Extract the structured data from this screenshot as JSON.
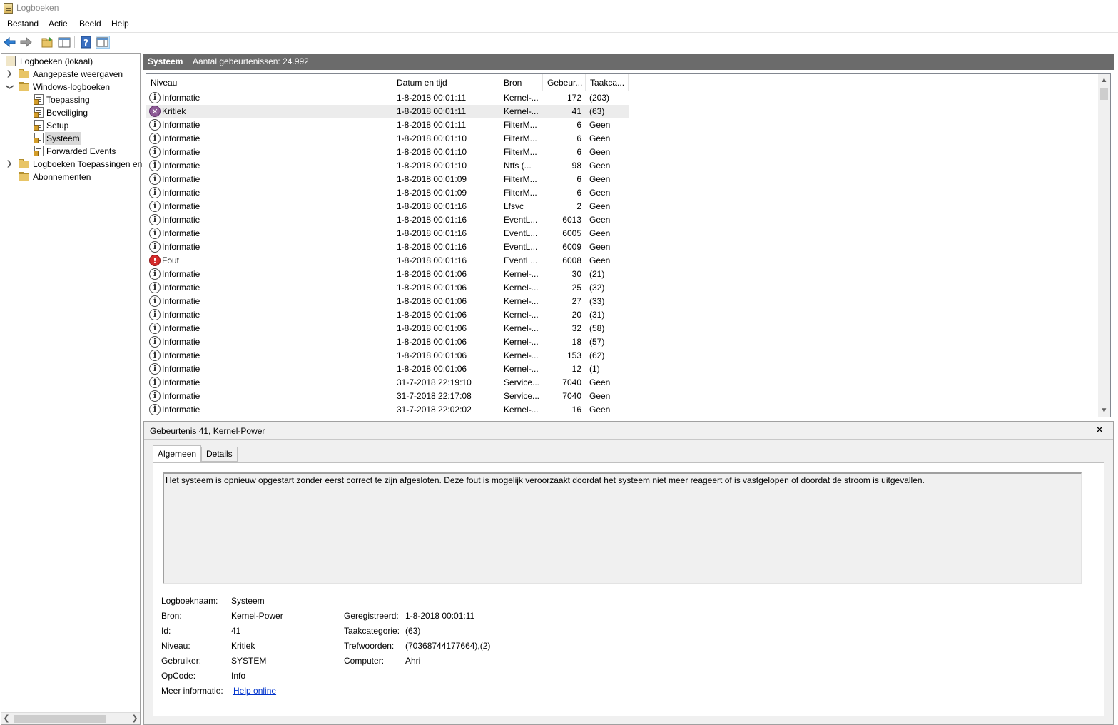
{
  "window": {
    "title": "Logboeken"
  },
  "menu": {
    "bestand": "Bestand",
    "actie": "Actie",
    "beeld": "Beeld",
    "help": "Help"
  },
  "toolbar": {
    "icons": [
      "back-arrow-icon",
      "forward-arrow-icon",
      "open-folder-icon",
      "show-hide-tree-icon",
      "help-icon",
      "show-hide-action-pane-icon"
    ]
  },
  "tree": {
    "root": "Logboeken (lokaal)",
    "custom_views": "Aangepaste weergaven",
    "windows_logs": "Windows-logboeken",
    "toepassing": "Toepassing",
    "beveiliging": "Beveiliging",
    "setup": "Setup",
    "systeem": "Systeem",
    "forwarded": "Forwarded Events",
    "app_logs": "Logboeken Toepassingen en",
    "subscriptions": "Abonnementen"
  },
  "header": {
    "name": "Systeem",
    "count": "Aantal gebeurtenissen: 24.992"
  },
  "columns": {
    "niveau": "Niveau",
    "datum": "Datum en tijd",
    "bron": "Bron",
    "id": "Gebeur...",
    "taak": "Taakca..."
  },
  "rows": [
    {
      "level": "Informatie",
      "type": "info",
      "date": "1-8-2018 00:01:11",
      "source": "Kernel-...",
      "id": "172",
      "task": "(203)"
    },
    {
      "level": "Kritiek",
      "type": "crit",
      "date": "1-8-2018 00:01:11",
      "source": "Kernel-...",
      "id": "41",
      "task": "(63)"
    },
    {
      "level": "Informatie",
      "type": "info",
      "date": "1-8-2018 00:01:11",
      "source": "FilterM...",
      "id": "6",
      "task": "Geen"
    },
    {
      "level": "Informatie",
      "type": "info",
      "date": "1-8-2018 00:01:10",
      "source": "FilterM...",
      "id": "6",
      "task": "Geen"
    },
    {
      "level": "Informatie",
      "type": "info",
      "date": "1-8-2018 00:01:10",
      "source": "FilterM...",
      "id": "6",
      "task": "Geen"
    },
    {
      "level": "Informatie",
      "type": "info",
      "date": "1-8-2018 00:01:10",
      "source": "Ntfs (...",
      "id": "98",
      "task": "Geen"
    },
    {
      "level": "Informatie",
      "type": "info",
      "date": "1-8-2018 00:01:09",
      "source": "FilterM...",
      "id": "6",
      "task": "Geen"
    },
    {
      "level": "Informatie",
      "type": "info",
      "date": "1-8-2018 00:01:09",
      "source": "FilterM...",
      "id": "6",
      "task": "Geen"
    },
    {
      "level": "Informatie",
      "type": "info",
      "date": "1-8-2018 00:01:16",
      "source": "Lfsvc",
      "id": "2",
      "task": "Geen"
    },
    {
      "level": "Informatie",
      "type": "info",
      "date": "1-8-2018 00:01:16",
      "source": "EventL...",
      "id": "6013",
      "task": "Geen"
    },
    {
      "level": "Informatie",
      "type": "info",
      "date": "1-8-2018 00:01:16",
      "source": "EventL...",
      "id": "6005",
      "task": "Geen"
    },
    {
      "level": "Informatie",
      "type": "info",
      "date": "1-8-2018 00:01:16",
      "source": "EventL...",
      "id": "6009",
      "task": "Geen"
    },
    {
      "level": "Fout",
      "type": "err",
      "date": "1-8-2018 00:01:16",
      "source": "EventL...",
      "id": "6008",
      "task": "Geen"
    },
    {
      "level": "Informatie",
      "type": "info",
      "date": "1-8-2018 00:01:06",
      "source": "Kernel-...",
      "id": "30",
      "task": "(21)"
    },
    {
      "level": "Informatie",
      "type": "info",
      "date": "1-8-2018 00:01:06",
      "source": "Kernel-...",
      "id": "25",
      "task": "(32)"
    },
    {
      "level": "Informatie",
      "type": "info",
      "date": "1-8-2018 00:01:06",
      "source": "Kernel-...",
      "id": "27",
      "task": "(33)"
    },
    {
      "level": "Informatie",
      "type": "info",
      "date": "1-8-2018 00:01:06",
      "source": "Kernel-...",
      "id": "20",
      "task": "(31)"
    },
    {
      "level": "Informatie",
      "type": "info",
      "date": "1-8-2018 00:01:06",
      "source": "Kernel-...",
      "id": "32",
      "task": "(58)"
    },
    {
      "level": "Informatie",
      "type": "info",
      "date": "1-8-2018 00:01:06",
      "source": "Kernel-...",
      "id": "18",
      "task": "(57)"
    },
    {
      "level": "Informatie",
      "type": "info",
      "date": "1-8-2018 00:01:06",
      "source": "Kernel-...",
      "id": "153",
      "task": "(62)"
    },
    {
      "level": "Informatie",
      "type": "info",
      "date": "1-8-2018 00:01:06",
      "source": "Kernel-...",
      "id": "12",
      "task": "(1)"
    },
    {
      "level": "Informatie",
      "type": "info",
      "date": "31-7-2018 22:19:10",
      "source": "Service...",
      "id": "7040",
      "task": "Geen"
    },
    {
      "level": "Informatie",
      "type": "info",
      "date": "31-7-2018 22:17:08",
      "source": "Service...",
      "id": "7040",
      "task": "Geen"
    },
    {
      "level": "Informatie",
      "type": "info",
      "date": "31-7-2018 22:02:02",
      "source": "Kernel-...",
      "id": "16",
      "task": "Geen"
    }
  ],
  "selected_row": 1,
  "detail": {
    "title": "Gebeurtenis 41, Kernel-Power",
    "close": "✕",
    "tab_general": "Algemeen",
    "tab_details": "Details",
    "description": "Het systeem is opnieuw opgestart zonder eerst correct te zijn afgesloten. Deze fout is mogelijk veroorzaakt doordat het systeem niet meer reageert of is vastgelopen of doordat de stroom is uitgevallen.",
    "labels": {
      "logname": "Logboeknaam:",
      "source": "Bron:",
      "id": "Id:",
      "level": "Niveau:",
      "user": "Gebruiker:",
      "opcode": "OpCode:",
      "more": "Meer informatie:",
      "logged": "Geregistreerd:",
      "task": "Taakcategorie:",
      "keywords": "Trefwoorden:",
      "computer": "Computer:"
    },
    "values": {
      "logname": "Systeem",
      "source": "Kernel-Power",
      "id": "41",
      "level": "Kritiek",
      "user": "SYSTEM",
      "opcode": "Info",
      "more": "Help online",
      "logged": "1-8-2018 00:01:11",
      "task": "(63)",
      "keywords": "(70368744177664),(2)",
      "computer": "Ahri"
    }
  },
  "colors": {
    "header_bg": "#6b6b6b",
    "selected_row": "#ececec",
    "link": "#0033cc"
  }
}
